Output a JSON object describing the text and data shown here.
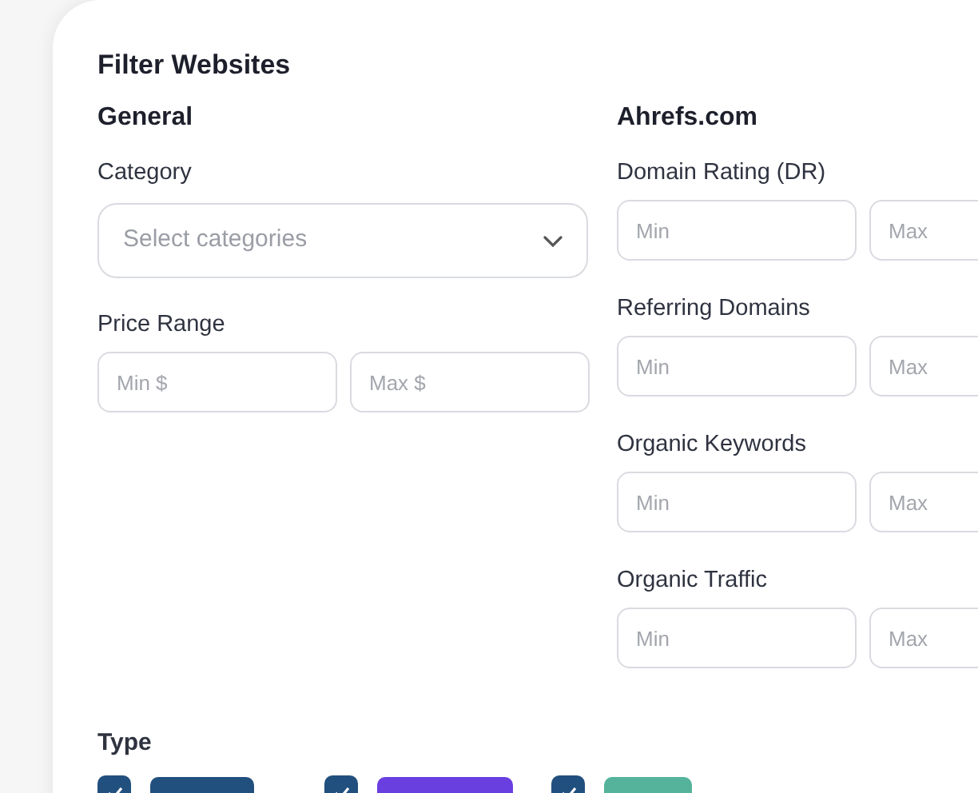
{
  "title": "Filter Websites",
  "general": {
    "heading": "General",
    "category": {
      "label": "Category",
      "placeholder": "Select categories"
    },
    "price_range": {
      "label": "Price Range",
      "min_placeholder": "Min $",
      "max_placeholder": "Max $"
    }
  },
  "ahrefs": {
    "heading": "Ahrefs.com",
    "ranges": [
      {
        "label": "Domain Rating (DR)",
        "min_placeholder": "Min",
        "max_placeholder": "Max"
      },
      {
        "label": "Referring Domains",
        "min_placeholder": "Min",
        "max_placeholder": "Max"
      },
      {
        "label": "Organic Keywords",
        "min_placeholder": "Min",
        "max_placeholder": "Max"
      },
      {
        "label": "Organic Traffic",
        "min_placeholder": "Min",
        "max_placeholder": "Max"
      }
    ]
  },
  "type": {
    "heading": "Type",
    "options": [
      {
        "checked": true,
        "color": "#22507e"
      },
      {
        "checked": true,
        "color": "#6a3fe0"
      },
      {
        "checked": true,
        "color": "#55b39b"
      }
    ]
  }
}
